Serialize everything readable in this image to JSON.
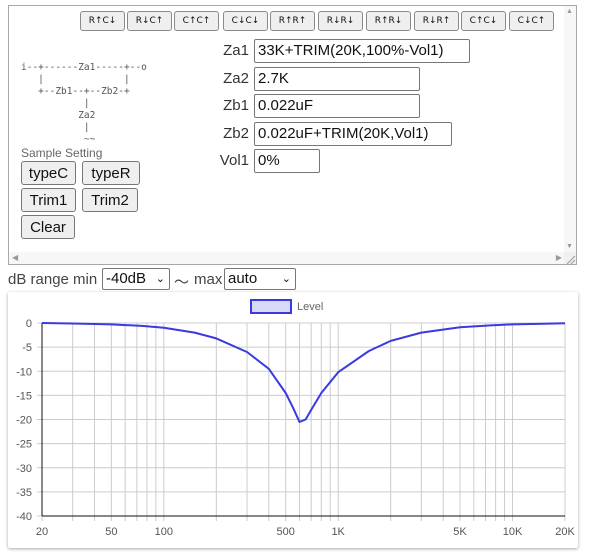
{
  "toolbar": {
    "buttons": [
      "R↑C↓",
      "R↓C↑",
      "C↑C↑",
      "C↓C↓",
      "R↑R↑",
      "R↓R↓",
      "R↑R↓",
      "R↓R↑",
      "C↑C↓",
      "C↓C↑"
    ]
  },
  "diagram": {
    "lines": [
      "i--+------Za1-----+--o",
      "   |              |",
      "   +--Zb1--+--Zb2-+",
      "           |",
      "          Za2",
      "           |",
      "           ~~"
    ]
  },
  "fields": [
    {
      "label": "Za1",
      "value": "33K+TRIM(20K,100%-Vol1)"
    },
    {
      "label": "Za2",
      "value": "2.7K"
    },
    {
      "label": "Zb1",
      "value": "0.022uF"
    },
    {
      "label": "Zb2",
      "value": "0.022uF+TRIM(20K,Vol1)"
    },
    {
      "label": "Vol1",
      "value": "0%"
    }
  ],
  "sample": {
    "title": "Sample Setting",
    "buttons": [
      "typeC",
      "typeR",
      "Trim1",
      "Trim2",
      "Clear"
    ]
  },
  "range": {
    "min_label": "dB range min",
    "min_value": "-40dB",
    "separator": "〜",
    "max_label": "max",
    "max_value": "auto"
  },
  "colors": {
    "line": "#3a3ae0",
    "legend_fill": "#d8d8f8",
    "grid": "#cccccc",
    "axis": "#111111"
  },
  "chart_data": {
    "type": "line",
    "title": "",
    "xlabel": "",
    "ylabel": "",
    "x_scale": "log",
    "xlim": [
      20,
      20000
    ],
    "ylim": [
      -40,
      0
    ],
    "grid": true,
    "legend": "top-center",
    "x_tick_labels": [
      "20",
      "50",
      "100",
      "500",
      "1K",
      "5K",
      "10K",
      "20K"
    ],
    "y_tick_labels": [
      "0",
      "-5",
      "-10",
      "-15",
      "-20",
      "-25",
      "-30",
      "-35",
      "-40"
    ],
    "series": [
      {
        "name": "Level",
        "x": [
          20,
          30,
          50,
          75,
          100,
          150,
          200,
          300,
          400,
          500,
          550,
          600,
          650,
          700,
          800,
          1000,
          1500,
          2000,
          3000,
          5000,
          7500,
          10000,
          15000,
          20000
        ],
        "y": [
          0,
          -0.1,
          -0.3,
          -0.6,
          -1.0,
          -2.0,
          -3.2,
          -6.0,
          -9.5,
          -14.5,
          -17.5,
          -20.5,
          -20.0,
          -18.0,
          -14.5,
          -10.2,
          -5.8,
          -3.7,
          -2.0,
          -0.9,
          -0.5,
          -0.3,
          -0.15,
          -0.05
        ]
      }
    ]
  }
}
